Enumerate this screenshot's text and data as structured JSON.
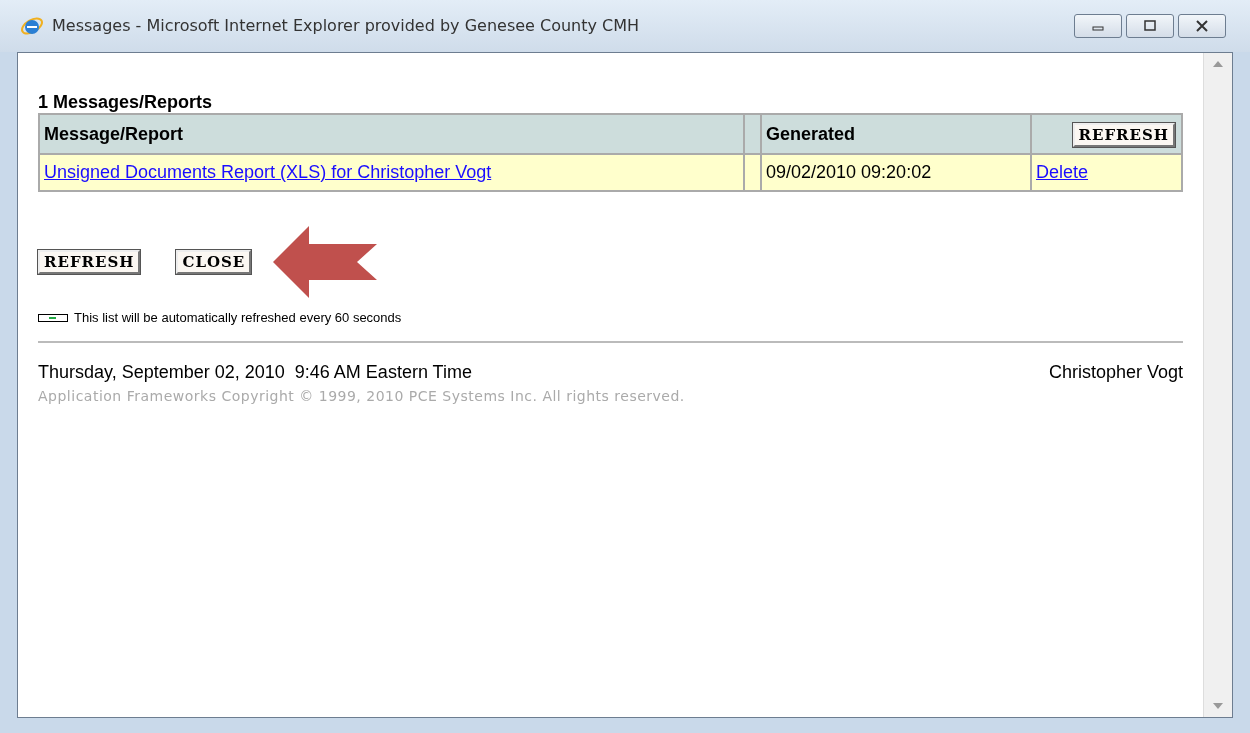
{
  "window": {
    "title": "Messages - Microsoft Internet Explorer provided by Genesee County CMH"
  },
  "heading": "1 Messages/Reports",
  "table": {
    "columns": [
      "Message/Report",
      "Generated"
    ],
    "header_button": "REFRESH",
    "rows": [
      {
        "message": "Unsigned Documents Report (XLS) for Christopher Vogt",
        "generated": "09/02/2010 09:20:02",
        "action": "Delete"
      }
    ]
  },
  "buttons": [
    "REFRESH",
    "CLOSE"
  ],
  "auto_refresh_note": "This list will be automatically refreshed every 60 seconds",
  "footer": {
    "datetime": "Thursday, September 02, 2010  9:46 AM Eastern Time",
    "user": "Christopher Vogt",
    "copyright": "Application Frameworks Copyright © 1999, 2010 PCE Systems Inc. All rights reserved."
  }
}
